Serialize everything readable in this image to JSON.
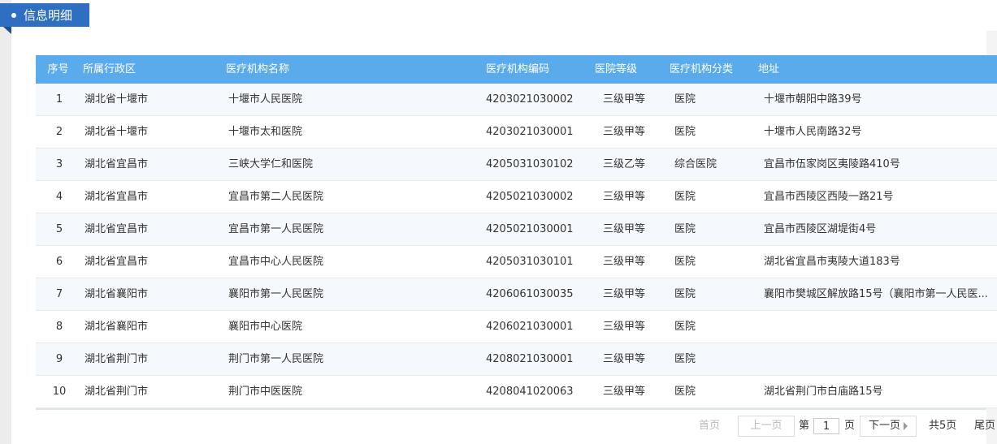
{
  "header": {
    "title": "信息明细"
  },
  "table": {
    "columns": [
      "序号",
      "所属行政区",
      "医疗机构名称",
      "医疗机构编码",
      "医院等级",
      "医疗机构分类",
      "地址"
    ],
    "rows": [
      [
        "1",
        "湖北省十堰市",
        "十堰市人民医院",
        "4203021030002",
        "三级甲等",
        "医院",
        "十堰市朝阳中路39号"
      ],
      [
        "2",
        "湖北省十堰市",
        "十堰市太和医院",
        "4203021030001",
        "三级甲等",
        "医院",
        "十堰市人民南路32号"
      ],
      [
        "3",
        "湖北省宜昌市",
        "三峡大学仁和医院",
        "4205031030102",
        "三级乙等",
        "综合医院",
        "宜昌市伍家岗区夷陵路410号"
      ],
      [
        "4",
        "湖北省宜昌市",
        "宜昌市第二人民医院",
        "4205021030002",
        "三级甲等",
        "医院",
        "宜昌市西陵区西陵一路21号"
      ],
      [
        "5",
        "湖北省宜昌市",
        "宜昌市第一人民医院",
        "4205021030001",
        "三级甲等",
        "医院",
        "宜昌市西陵区湖堤街4号"
      ],
      [
        "6",
        "湖北省宜昌市",
        "宜昌市中心人民医院",
        "4205031030101",
        "三级甲等",
        "医院",
        "湖北省宜昌市夷陵大道183号"
      ],
      [
        "7",
        "湖北省襄阳市",
        "襄阳市第一人民医院",
        "4206061030035",
        "三级甲等",
        "医院",
        "襄阳市樊城区解放路15号（襄阳市第一人民医..."
      ],
      [
        "8",
        "湖北省襄阳市",
        "襄阳市中心医院",
        "4206021030001",
        "三级甲等",
        "医院",
        ""
      ],
      [
        "9",
        "湖北省荆门市",
        "荆门市第一人民医院",
        "4208021030001",
        "三级甲等",
        "医院",
        ""
      ],
      [
        "10",
        "湖北省荆门市",
        "荆门市中医医院",
        "4208041020063",
        "三级甲等",
        "医院",
        "湖北省荆门市白庙路15号"
      ]
    ]
  },
  "pager": {
    "first": "首页",
    "prev": "上一页",
    "page_prefix": "第",
    "current_page": "1",
    "page_suffix": "页",
    "next": "下一页",
    "total": "共5页",
    "last": "尾页"
  },
  "colors": {
    "accent": "#2f6fc1",
    "table_header": "#5aabec"
  },
  "icons": {
    "header": "bullet-dot-icon",
    "next": "chevron-right-icon"
  }
}
